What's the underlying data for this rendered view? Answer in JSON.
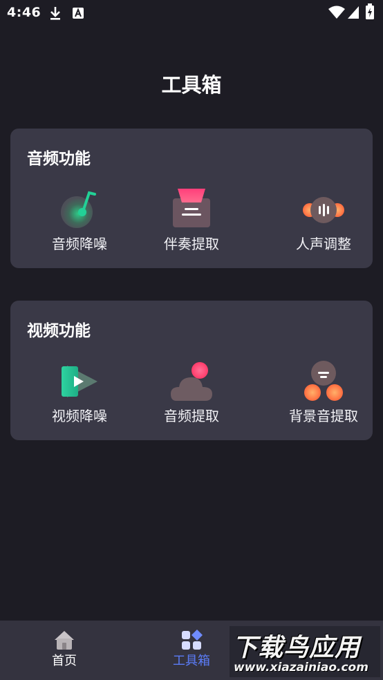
{
  "status_bar": {
    "time": "4:46"
  },
  "page_title": "工具箱",
  "audio_section": {
    "title": "音频功能",
    "tools": [
      {
        "label": "音频降噪",
        "icon": "audio-denoise-icon"
      },
      {
        "label": "伴奏提取",
        "icon": "accompaniment-extract-icon"
      },
      {
        "label": "人声调整",
        "icon": "vocal-adjust-icon"
      }
    ]
  },
  "video_section": {
    "title": "视频功能",
    "tools": [
      {
        "label": "视频降噪",
        "icon": "video-denoise-icon"
      },
      {
        "label": "音频提取",
        "icon": "audio-extract-icon"
      },
      {
        "label": "背景音提取",
        "icon": "background-sound-extract-icon"
      }
    ]
  },
  "bottom_nav": {
    "items": [
      {
        "label": "首页",
        "icon": "home-icon",
        "active": false
      },
      {
        "label": "工具箱",
        "icon": "toolbox-icon",
        "active": true
      }
    ]
  },
  "colors": {
    "background": "#1d1c24",
    "card": "#3a3947",
    "nav_active": "#5b7cf7",
    "nav_bar": "#34333f"
  },
  "watermark": {
    "title": "下载鸟应用",
    "url": "www.xiazainiao.com"
  }
}
